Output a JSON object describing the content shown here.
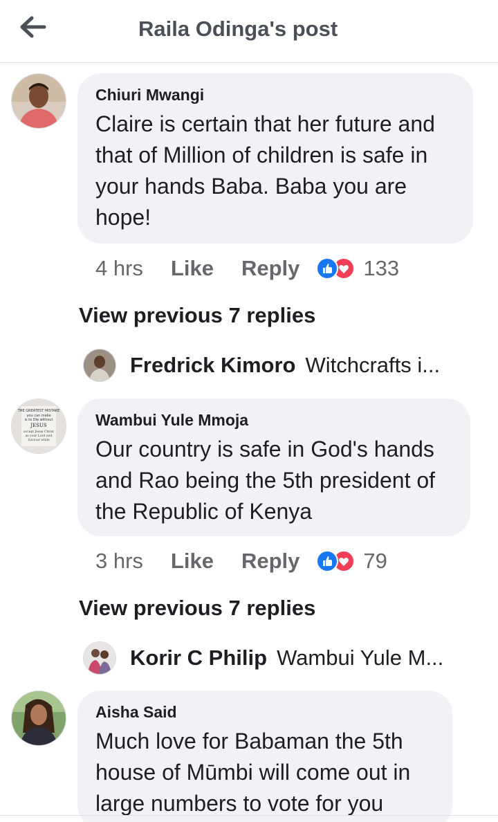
{
  "header": {
    "title": "Raila Odinga's post",
    "back_icon": "arrow-left-icon"
  },
  "comments": [
    {
      "author": "Chiuri Mwangi",
      "text": "Claire is certain that her future and that of Million of children is safe in your hands Baba. Baba you are hope!",
      "time": "4 hrs",
      "like_label": "Like",
      "reply_label": "Reply",
      "reactions": [
        "like",
        "love"
      ],
      "reaction_count": "133",
      "view_previous": "View previous 7 replies",
      "reply_preview": {
        "author": "Fredrick Kimoro",
        "text": "Witchcrafts i..."
      }
    },
    {
      "author": "Wambui Yule Mmoja",
      "text": "Our country is safe in God's hands and Rao being the 5th president of the Republic of Kenya",
      "time": "3 hrs",
      "like_label": "Like",
      "reply_label": "Reply",
      "reactions": [
        "like",
        "love"
      ],
      "reaction_count": "79",
      "view_previous": "View previous 7 replies",
      "reply_preview": {
        "author": "Korir C Philip",
        "text": "Wambui Yule M..."
      },
      "avatar_text": [
        "THE GREATEST MISTAKE",
        "you can make",
        "is to Die without",
        "JESUS",
        "accept Jesus Christ",
        "as your Lord and",
        "Saviour while"
      ]
    },
    {
      "author": "Aisha Said",
      "text": "Much love for Babaman the 5th house of Mūmbi will come out in large numbers to vote for you"
    }
  ],
  "colors": {
    "bubble": "#f0f2f5",
    "meta_text": "#65676b",
    "like_blue": "#1877f2",
    "love_red": "#f33e58"
  }
}
